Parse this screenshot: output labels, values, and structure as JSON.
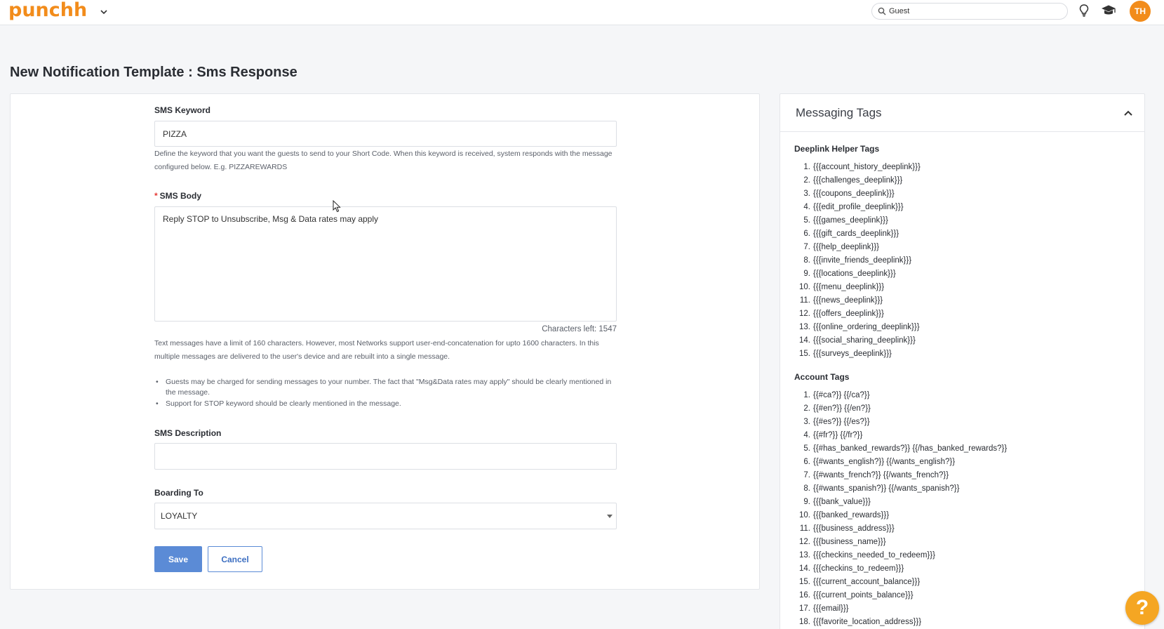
{
  "header": {
    "logo_text": "punchh",
    "search_value": "Guest",
    "avatar_initials": "TH",
    "icons": [
      "chevron-down-icon",
      "search-icon",
      "lightbulb-icon",
      "graduation-cap-icon"
    ]
  },
  "page": {
    "title": "New Notification Template : Sms Response"
  },
  "form": {
    "keyword_label": "SMS Keyword",
    "keyword_value": "PIZZA",
    "keyword_help": "Define the keyword that you want the guests to send to your Short Code. When this keyword is received, system responds with the message configured below. E.g. PIZZAREWARDS",
    "body_required_mark": "*",
    "body_label": "SMS Body",
    "body_value": "Reply STOP to Unsubscribe, Msg & Data rates may apply",
    "chars_left": "Characters left: 1547",
    "limit_help": "Text messages have a limit of 160 characters. However, most Networks support user-end-concatenation for upto 1600 characters. In this multiple messages are delivered to the user's device and are rebuilt into a single message.",
    "bullets": [
      "Guests may be charged for sending messages to your number. The fact that \"Msg&Data rates may apply\" should be clearly mentioned in the message.",
      "Support for STOP keyword should be clearly mentioned in the message."
    ],
    "description_label": "SMS Description",
    "description_value": "",
    "boarding_label": "Boarding To",
    "boarding_value": "LOYALTY",
    "save_label": "Save",
    "cancel_label": "Cancel"
  },
  "tags": {
    "title": "Messaging Tags",
    "deeplink_title": "Deeplink Helper Tags",
    "deeplink": [
      {
        "n": "1.",
        "t": "{{{account_history_deeplink}}}"
      },
      {
        "n": "2.",
        "t": "{{{challenges_deeplink}}}"
      },
      {
        "n": "3.",
        "t": "{{{coupons_deeplink}}}"
      },
      {
        "n": "4.",
        "t": "{{{edit_profile_deeplink}}}"
      },
      {
        "n": "5.",
        "t": "{{{games_deeplink}}}"
      },
      {
        "n": "6.",
        "t": "{{{gift_cards_deeplink}}}"
      },
      {
        "n": "7.",
        "t": "{{{help_deeplink}}}"
      },
      {
        "n": "8.",
        "t": "{{{invite_friends_deeplink}}}"
      },
      {
        "n": "9.",
        "t": "{{{locations_deeplink}}}"
      },
      {
        "n": "10.",
        "t": "{{{menu_deeplink}}}"
      },
      {
        "n": "11.",
        "t": "{{{news_deeplink}}}"
      },
      {
        "n": "12.",
        "t": "{{{offers_deeplink}}}"
      },
      {
        "n": "13.",
        "t": "{{{online_ordering_deeplink}}}"
      },
      {
        "n": "14.",
        "t": "{{{social_sharing_deeplink}}}"
      },
      {
        "n": "15.",
        "t": "{{{surveys_deeplink}}}"
      }
    ],
    "account_title": "Account Tags",
    "account": [
      {
        "n": "1.",
        "t": "{{#ca?}} {{/ca?}}"
      },
      {
        "n": "2.",
        "t": "{{#en?}} {{/en?}}"
      },
      {
        "n": "3.",
        "t": "{{#es?}} {{/es?}}"
      },
      {
        "n": "4.",
        "t": "{{#fr?}} {{/fr?}}"
      },
      {
        "n": "5.",
        "t": "{{#has_banked_rewards?}} {{/has_banked_rewards?}}"
      },
      {
        "n": "6.",
        "t": "{{#wants_english?}} {{/wants_english?}}"
      },
      {
        "n": "7.",
        "t": "{{#wants_french?}} {{/wants_french?}}"
      },
      {
        "n": "8.",
        "t": "{{#wants_spanish?}} {{/wants_spanish?}}"
      },
      {
        "n": "9.",
        "t": "{{{bank_value}}}"
      },
      {
        "n": "10.",
        "t": "{{{banked_rewards}}}"
      },
      {
        "n": "11.",
        "t": "{{{business_address}}}"
      },
      {
        "n": "12.",
        "t": "{{{business_name}}}"
      },
      {
        "n": "13.",
        "t": "{{{checkins_needed_to_redeem}}}"
      },
      {
        "n": "14.",
        "t": "{{{checkins_to_redeem}}}"
      },
      {
        "n": "15.",
        "t": "{{{current_account_balance}}}"
      },
      {
        "n": "16.",
        "t": "{{{current_points_balance}}}"
      },
      {
        "n": "17.",
        "t": "{{{email}}}"
      },
      {
        "n": "18.",
        "t": "{{{favorite_location_address}}}"
      }
    ]
  },
  "help_fab": "?",
  "colors": {
    "brand": "#f28c1b",
    "primary": "#5b8bd6",
    "required": "#e53935",
    "fab": "#f5a623"
  }
}
